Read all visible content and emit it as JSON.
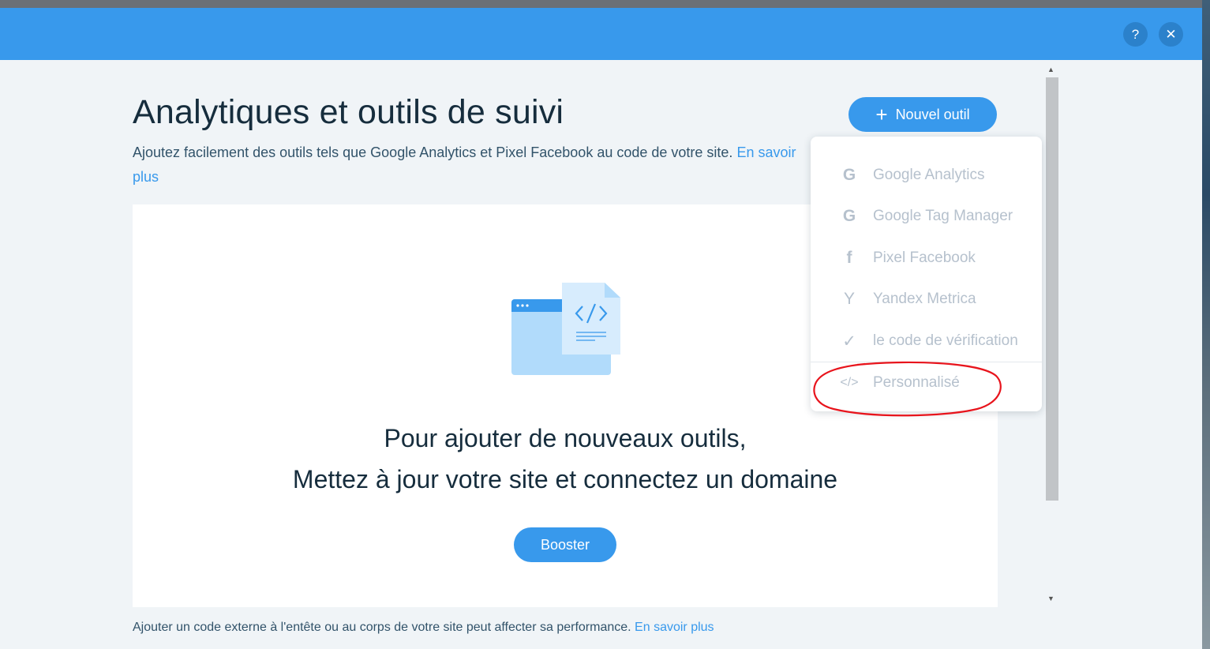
{
  "modal": {
    "help_icon": "?",
    "close_icon": "✕"
  },
  "page": {
    "title": "Analytiques et outils de suivi",
    "subtitle": "Ajoutez facilement des outils tels que Google Analytics et Pixel Facebook au code de votre site.",
    "subtitle_link": "En savoir plus"
  },
  "toolbar": {
    "new_tool_label": "Nouvel outil",
    "new_tool_icon": "+"
  },
  "dropdown": {
    "items": [
      {
        "icon": "G",
        "icon_name": "google-icon",
        "label": "Google Analytics"
      },
      {
        "icon": "G",
        "icon_name": "google-icon",
        "label": "Google Tag Manager"
      },
      {
        "icon": "f",
        "icon_name": "facebook-icon",
        "label": "Pixel Facebook"
      },
      {
        "icon": "Y",
        "icon_name": "yandex-icon",
        "label": "Yandex Metrica"
      },
      {
        "icon": "✓",
        "icon_name": "check-icon",
        "label": "le code de vérification"
      },
      {
        "icon": "</>",
        "icon_name": "code-icon",
        "label": "Personnalisé"
      }
    ]
  },
  "card": {
    "line1": "Pour ajouter de nouveaux outils,",
    "line2": "Mettez à jour votre site et connectez un domaine",
    "button_label": "Booster"
  },
  "footer": {
    "note": "Ajouter un code externe à l'entête ou au corps de votre site peut affecter sa performance.",
    "link": "En savoir plus"
  },
  "colors": {
    "header": "#3899ec",
    "accent": "#3899ec",
    "title_text": "#162d3d",
    "disabled_text": "#b6c1cd",
    "annotation": "#e8141c"
  }
}
